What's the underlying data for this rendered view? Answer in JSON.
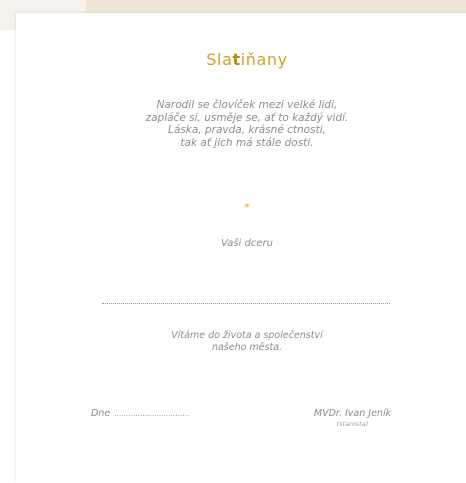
{
  "logo": {
    "part1": "Sla",
    "part2": "t",
    "part3": "iňany"
  },
  "poem": {
    "lines": [
      "Narodil se človíček mezi velké lidi,",
      "zapláče si, usměje se, ať to každý vidí.",
      "Láska, pravda, krásné ctnosti,",
      "tak ať jich má stále dosti."
    ]
  },
  "ornament": "*",
  "recipient": "Vaši dceru",
  "welcome": {
    "lines": [
      "Vítáme do života a společenství",
      "našeho města."
    ]
  },
  "date": {
    "label": "Dne",
    "blank": "................................"
  },
  "signatory": {
    "name": "MVDr. Ivan Jeník",
    "role": "(starosta)"
  }
}
